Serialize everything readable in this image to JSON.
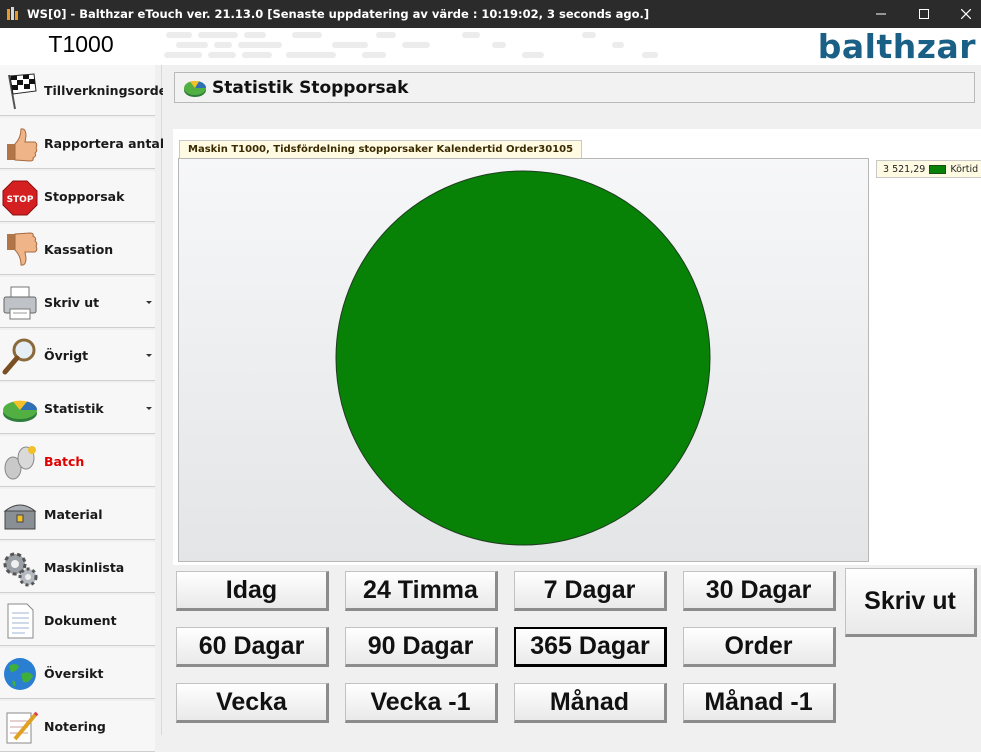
{
  "window": {
    "title": "WS[0] - Balthzar eTouch ver. 21.13.0  [Senaste uppdatering av värde : 10:19:02, 3 seconds ago.]"
  },
  "header": {
    "machine": "T1000",
    "brand": "balthzar"
  },
  "sidebar": {
    "items": [
      {
        "label": "Tillverkningsorder",
        "icon": "checkered-flag-icon"
      },
      {
        "label": "Rapportera antal",
        "icon": "thumbs-up-icon"
      },
      {
        "label": "Stopporsak",
        "icon": "stop-sign-icon"
      },
      {
        "label": "Kassation",
        "icon": "thumbs-down-icon"
      },
      {
        "label": "Skriv ut",
        "icon": "printer-icon",
        "has_submenu": true
      },
      {
        "label": "Övrigt",
        "icon": "magnifier-icon",
        "has_submenu": true
      },
      {
        "label": "Statistik",
        "icon": "pie-chart-icon",
        "has_submenu": true
      },
      {
        "label": "Batch",
        "icon": "batch-icon",
        "highlight_color": "#e00000"
      },
      {
        "label": "Material",
        "icon": "treasure-chest-icon"
      },
      {
        "label": "Maskinlista",
        "icon": "gears-icon"
      },
      {
        "label": "Dokument",
        "icon": "document-icon"
      },
      {
        "label": "Översikt",
        "icon": "globe-icon"
      },
      {
        "label": "Notering",
        "icon": "notepad-icon"
      }
    ]
  },
  "main": {
    "title": "Statistik Stopporsak",
    "chart_tab": "Maskin T1000, Tidsfördelning stopporsaker Kalendertid Order30105",
    "legend": {
      "value": "3 521,29",
      "label": "Körtid"
    }
  },
  "chart_data": {
    "type": "pie",
    "title": "Maskin T1000, Tidsfördelning stopporsaker Kalendertid Order30105",
    "slices": [
      {
        "label": "Körtid",
        "value": 3521.29,
        "color": "#078207"
      }
    ],
    "legend_position": "right"
  },
  "buttons": {
    "row1": [
      "Idag",
      "24 Timma",
      "7 Dagar",
      "30 Dagar"
    ],
    "row2": [
      "60 Dagar",
      "90 Dagar",
      "365 Dagar",
      "Order"
    ],
    "row3": [
      "Vecka",
      "Vecka -1",
      "Månad",
      "Månad -1"
    ],
    "print": "Skriv ut",
    "active": "365 Dagar"
  },
  "colors": {
    "brand": "#1a5f86",
    "pie": "#078207",
    "titlebar": "#2b2b2b"
  }
}
